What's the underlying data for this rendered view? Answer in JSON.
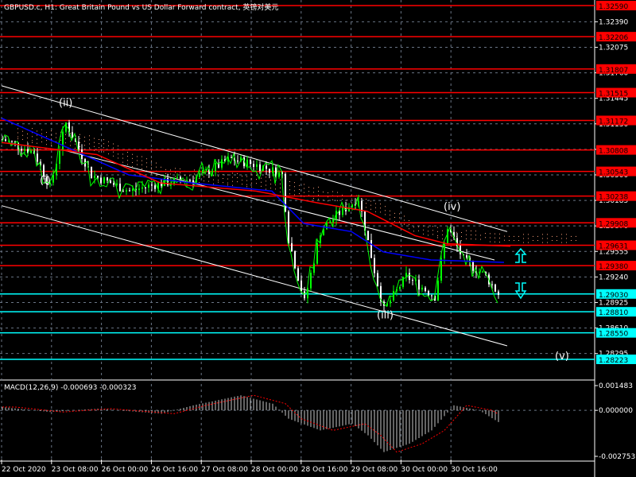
{
  "header": {
    "title": "GBPUSD.c, H1:  Great Britain Pound vs US Dollar Forward contract, 英镑对美元"
  },
  "macd_label": "MACD(12,26,9) -0.000693 -0.000323",
  "colors": {
    "bg": "#000000",
    "red": "#ff0000",
    "cyan": "#00ffff",
    "bull": "#00ff00",
    "bear": "#ffffff",
    "ma_red": "#ff0000",
    "ma_blue": "#0000ff",
    "cloud": "#ffa07a",
    "grid": "#6a7585"
  },
  "chart_data": {
    "type": "candlestick",
    "symbol": "GBPUSD.c",
    "timeframe": "H1",
    "ylim": [
      1.28223,
      1.3259
    ],
    "price_ticks": [
      "1.32390",
      "1.32075",
      "1.31760",
      "1.31445",
      "1.31130",
      "1.30815",
      "1.30500",
      "1.30185",
      "1.29870",
      "1.29555",
      "1.29240",
      "1.28925",
      "1.28610",
      "1.28295"
    ],
    "time_ticks": [
      "22 Oct 2020",
      "23 Oct 08:00",
      "26 Oct 00:00",
      "26 Oct 16:00",
      "27 Oct 08:00",
      "28 Oct 00:00",
      "28 Oct 16:00",
      "29 Oct 08:00",
      "30 Oct 00:00",
      "30 Oct 16:00"
    ],
    "resistance_levels": [
      "1.32590",
      "1.32206",
      "1.31807",
      "1.31515",
      "1.31172",
      "1.30808",
      "1.30543",
      "1.30238",
      "1.29908",
      "1.29631",
      "1.29380"
    ],
    "support_levels": [
      "1.29030",
      "1.28810",
      "1.28550",
      "1.28223"
    ],
    "price_path": [
      [
        0,
        1.3094
      ],
      [
        10,
        1.3078
      ],
      [
        15,
        1.3035
      ],
      [
        20,
        1.3114
      ],
      [
        28,
        1.305
      ],
      [
        40,
        1.303
      ],
      [
        50,
        1.304
      ],
      [
        60,
        1.3045
      ],
      [
        72,
        1.307
      ],
      [
        82,
        1.306
      ],
      [
        88,
        1.305
      ],
      [
        90,
        1.2971
      ],
      [
        95,
        1.2893
      ],
      [
        100,
        1.298
      ],
      [
        105,
        1.3
      ],
      [
        112,
        1.3021
      ],
      [
        117,
        1.2932
      ],
      [
        120,
        1.2883
      ],
      [
        127,
        1.2925
      ],
      [
        136,
        1.29
      ],
      [
        140,
        1.2986
      ],
      [
        145,
        1.2945
      ],
      [
        152,
        1.2925
      ],
      [
        156,
        1.2903
      ]
    ],
    "channel": [
      {
        "name": "upper",
        "from": [
          0,
          1.316
        ],
        "to": [
          159,
          1.298
        ]
      },
      {
        "name": "middle",
        "from": [
          20,
          1.308
        ],
        "to": [
          155,
          1.2945
        ]
      },
      {
        "name": "lower",
        "from": [
          0,
          1.3012
        ],
        "to": [
          159,
          1.2839
        ]
      }
    ],
    "ma_red": [
      [
        0,
        1.309
      ],
      [
        30,
        1.3075
      ],
      [
        50,
        1.304
      ],
      [
        80,
        1.303
      ],
      [
        100,
        1.3015
      ],
      [
        115,
        1.3005
      ],
      [
        130,
        1.2975
      ],
      [
        140,
        1.2965
      ],
      [
        160,
        1.2962
      ]
    ],
    "ma_blue": [
      [
        0,
        1.312
      ],
      [
        20,
        1.3085
      ],
      [
        40,
        1.305
      ],
      [
        60,
        1.304
      ],
      [
        85,
        1.303
      ],
      [
        95,
        1.299
      ],
      [
        110,
        1.298
      ],
      [
        120,
        1.2955
      ],
      [
        135,
        1.2945
      ],
      [
        158,
        1.2942
      ]
    ],
    "waves": [
      {
        "label": "(i)",
        "bar": 14,
        "price": 1.3039
      },
      {
        "label": "(ii)",
        "bar": 20,
        "price": 1.3135
      },
      {
        "label": "(iii)",
        "bar": 120,
        "price": 1.2873
      },
      {
        "label": "(iv)",
        "bar": 141,
        "price": 1.3007
      },
      {
        "label": "(v)",
        "bar": 176,
        "price": 1.28223
      }
    ],
    "macd": {
      "label": "MACD(12,26,9)",
      "main": -0.000693,
      "signal": -0.000323,
      "ylim": [
        -0.002753,
        0.001483
      ],
      "ticks": [
        "0.001483",
        "0.000000",
        "-0.002753"
      ],
      "hist_path": [
        [
          0,
          0.0002
        ],
        [
          15,
          -0.0001
        ],
        [
          30,
          0.0001
        ],
        [
          50,
          -0.0002
        ],
        [
          60,
          0.0003
        ],
        [
          75,
          0.0009
        ],
        [
          85,
          0.0004
        ],
        [
          90,
          -0.0005
        ],
        [
          100,
          -0.0012
        ],
        [
          110,
          -0.0008
        ],
        [
          115,
          -0.0015
        ],
        [
          120,
          -0.0025
        ],
        [
          128,
          -0.002
        ],
        [
          135,
          -0.0012
        ],
        [
          142,
          0.0003
        ],
        [
          150,
          0.0
        ],
        [
          156,
          -0.0007
        ]
      ]
    }
  }
}
